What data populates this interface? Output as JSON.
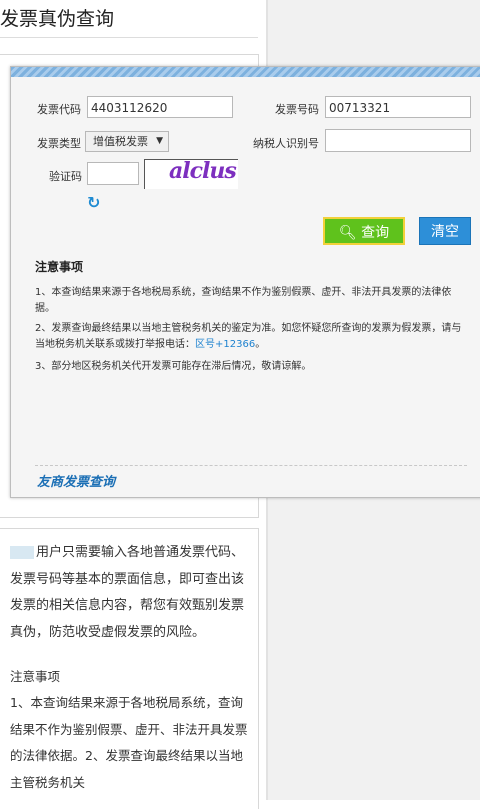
{
  "page": {
    "title": "发票真伪查询"
  },
  "form": {
    "invoice_code_label": "发票代码",
    "invoice_code_value": "4403112620",
    "invoice_number_label": "发票号码",
    "invoice_number_value": "00713321",
    "invoice_type_label": "发票类型",
    "invoice_type_selected": "增值税发票",
    "taxpayer_id_label": "纳税人识别号",
    "taxpayer_id_value": "",
    "captcha_label": "验证码",
    "captcha_value": "",
    "captcha_text": "alclus",
    "query_button": "查询",
    "clear_button": "清空"
  },
  "notice": {
    "heading": "注意事项",
    "item1": "1、本查询结果来源于各地税局系统，查询结果不作为鉴别假票、虚开、非法开具发票的法律依据。",
    "item2_text": "2、发票查询最终结果以当地主管税务机关的鉴定为准。如您怀疑您所查询的发票为假发票，请与当地税务机关联系或拨打举报电话：",
    "item2_link": "区号+12366",
    "item2_end": "。",
    "item3": "3、部分地区税务机关代开发票可能存在滞后情况，敬请谅解。"
  },
  "brand": {
    "logo_text": "友商发票查询"
  },
  "description": {
    "intro": "用户只需要输入各地普通发票代码、发票号码等基本的票面信息，即可查出该发票的相关信息内容，帮您有效甄别发票真伪，防范收受虚假发票的风险。",
    "notes_heading": "注意事项",
    "notes_text": "1、本查询结果来源于各地税局系统，查询结果不作为鉴别假票、虚开、非法开具发票的法律依据。2、发票查询最终结果以当地主管税务机关"
  },
  "colors": {
    "query_button": "#5fc21c",
    "clear_button": "#2d8fd8",
    "link": "#1e82cf"
  }
}
